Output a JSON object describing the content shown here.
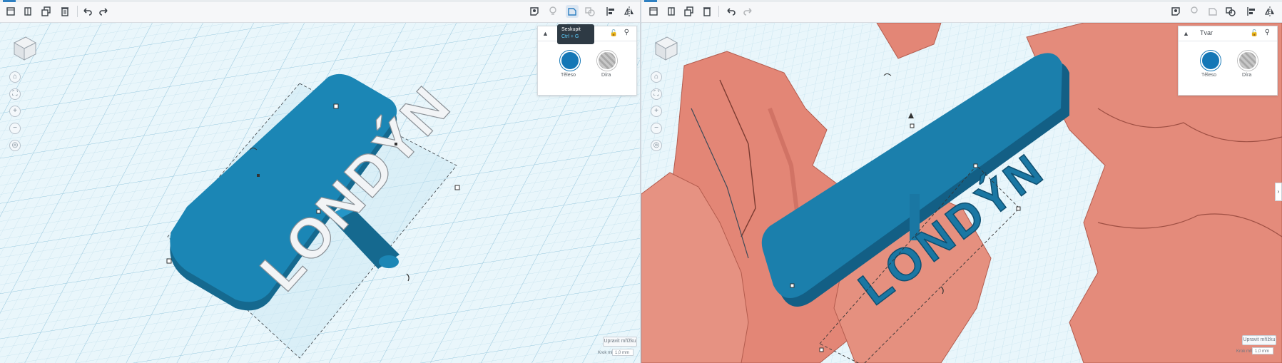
{
  "left": {
    "model_text": "LONDÝN",
    "tooltip": {
      "title": "Seskupit",
      "shortcut": "Ctrl + G"
    },
    "shape_panel": {
      "title": "",
      "solid_label": "Těleso",
      "hole_label": "Díra"
    },
    "edit_grid": "Upravit mřížku",
    "snap_label": "Krok mřížky",
    "snap_value": "1,0 mm"
  },
  "right": {
    "model_text": "LONDÝN",
    "shape_panel": {
      "title": "Tvar",
      "solid_label": "Těleso",
      "hole_label": "Díra"
    },
    "edit_grid": "Upravit mřížku",
    "snap_label": "Krok mřížky",
    "snap_value": "1,0 mm"
  },
  "colors": {
    "shape_blue": "#1477b6",
    "terrain": "#e58a7c",
    "workplane": "#e9f6fb",
    "toolbar": "#f6f7f9"
  },
  "icons": [
    "new-shape-icon",
    "duplicate-icon",
    "copy-icon",
    "delete-icon",
    "undo-icon",
    "redo-icon",
    "note-icon",
    "light-icon",
    "group-icon",
    "ungroup-icon",
    "align-icon",
    "mirror-icon"
  ]
}
